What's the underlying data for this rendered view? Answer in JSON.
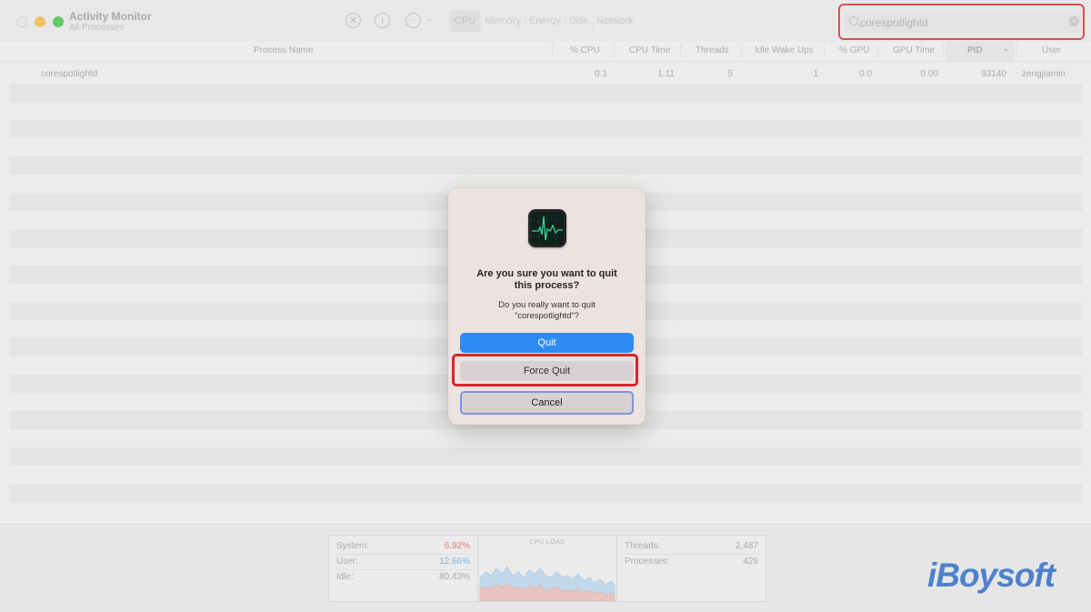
{
  "window": {
    "title": "Activity Monitor",
    "subtitle": "All Processes"
  },
  "toolbar": {
    "icons": [
      "stop-icon",
      "info-icon",
      "more-icon"
    ],
    "info_glyph": "i",
    "more_glyph": "···",
    "stop_glyph": "✕",
    "chevron": "⌄",
    "tabs": [
      "CPU",
      "Memory",
      "Energy",
      "Disk",
      "Network"
    ],
    "active_tab": "CPU",
    "search_value": "corespotlightd",
    "clear_glyph": "✕"
  },
  "columns": {
    "process_name": "Process Name",
    "cpu": "% CPU",
    "cpu_time": "CPU Time",
    "threads": "Threads",
    "idle_wake_ups": "Idle Wake Ups",
    "gpu": "% GPU",
    "gpu_time": "GPU Time",
    "pid": "PID",
    "user": "User",
    "sort_indicator": "⌄"
  },
  "process": {
    "name": "corespotlightd",
    "cpu": "0.1",
    "cpu_time": "1.11",
    "threads": "5",
    "idle_wake_ups": "1",
    "gpu": "0.0",
    "gpu_time": "0.00",
    "pid": "93140",
    "user": "zengjiamin"
  },
  "stats": {
    "system_label": "System:",
    "system_value": "6.92%",
    "user_label": "User:",
    "user_value": "12.66%",
    "idle_label": "Idle:",
    "idle_value": "80.43%",
    "cpu_load_title": "CPU LOAD",
    "threads_label": "Threads:",
    "threads_value": "2,487",
    "processes_label": "Processes:",
    "processes_value": "429"
  },
  "colors": {
    "system": "#e0605a",
    "user": "#58a6e6",
    "accent": "#2d8cf4",
    "highlight": "#d9252a",
    "brand": "#1f63c6"
  },
  "dialog": {
    "title": "Are you sure you want to quit\nthis process?",
    "message": "Do you really want to quit\n“corespotlightd”?",
    "quit_label": "Quit",
    "force_quit_label": "Force Quit",
    "cancel_label": "Cancel"
  },
  "watermark": {
    "brand": "iBoysoft"
  }
}
